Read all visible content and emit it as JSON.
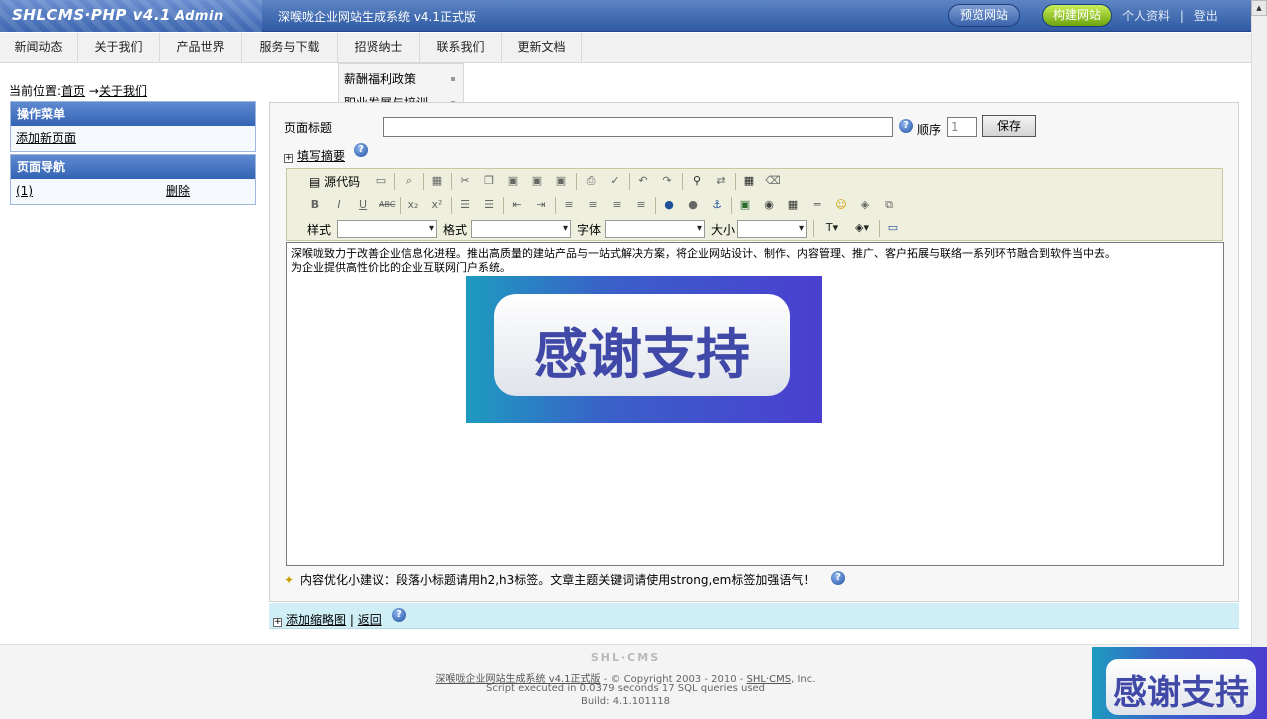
{
  "header": {
    "logo": "SHLCMS·PHP v4.1",
    "logo_suffix": "Admin",
    "system_title": "深喉咙企业网站生成系统 v4.1正式版",
    "preview_button": "预览网站",
    "build_button": "构建网站",
    "profile_link": "个人资料",
    "separator": "|",
    "logout_link": "登出"
  },
  "nav": {
    "items": [
      "新闻动态",
      "关于我们",
      "产品世界",
      "服务与下载",
      "招贤纳士",
      "联系我们",
      "更新文档"
    ],
    "dropdown": [
      "薪酬福利政策",
      "职业发展与培训"
    ]
  },
  "breadcrumb": {
    "prefix": "当前位置:",
    "home": "首页",
    "arrow": "→",
    "current": "关于我们"
  },
  "sidebar": {
    "menu_title": "操作菜单",
    "add_page": "添加新页面",
    "nav_title": "页面导航",
    "page_item": "(1)",
    "delete": "删除"
  },
  "form": {
    "title_label": "页面标题",
    "title_value": "",
    "order_label": "顺序",
    "order_value": "1",
    "save_button": "保存",
    "summary_toggle": "+",
    "summary_link": "填写摘要"
  },
  "editor": {
    "source_button": "源代码",
    "style_label": "样式",
    "format_label": "格式",
    "font_label": "字体",
    "size_label": "大小",
    "content_line1": "深喉咙致力于改善企业信息化进程。推出高质量的建站产品与一站式解决方案，将企业网站设计、制作、内容管理、推广、客户拓展与联络一系列环节融合到软件当中去。",
    "content_line2": "为企业提供高性价比的企业互联网门户系统。",
    "image_text": "感谢支持",
    "tip": "内容优化小建议：段落小标题请用h2,h3标签。文章主题关键词请使用strong,em标签加强语气！"
  },
  "thumb_bar": {
    "add_thumb": "添加缩略图",
    "separator": "|",
    "back": "返回"
  },
  "footer": {
    "brand": "SHL·CMS",
    "product_link": "深喉咙企业网站生成系统 v4.1正式版",
    "copyright": " - © Copyright 2003 - 2010 - ",
    "company_link": "SHL·CMS",
    "company_suffix": ", Inc.",
    "script_info": "Script executed in 0.0379 seconds 17 SQL queries used",
    "build": "Build: 4.1.101118",
    "corner_image_text": "感谢支持"
  },
  "colors": {
    "header_blue": "#2f5aa3",
    "build_green": "#6da30d",
    "sidebar_head": "#3363b4",
    "toolbar_bg": "#efefde",
    "thumb_bar": "#cfeef5"
  }
}
